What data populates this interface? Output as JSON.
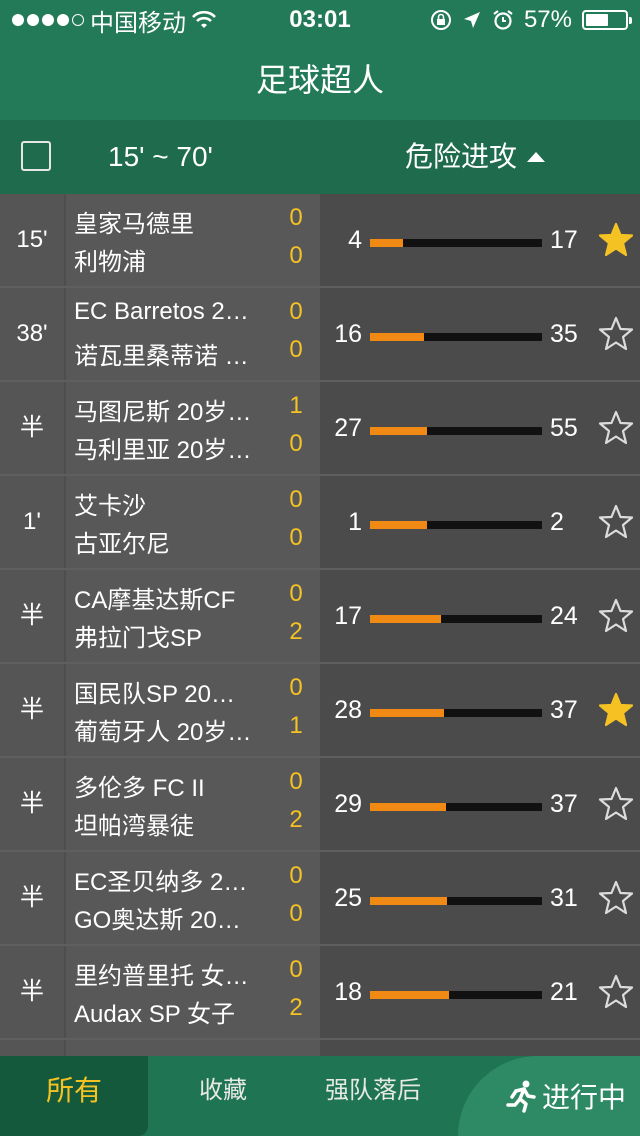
{
  "status_bar": {
    "carrier": "中国移动",
    "time": "03:01",
    "battery": "57%",
    "battery_level": 0.57
  },
  "title": "足球超人",
  "header": {
    "range": "15' ~ 70'",
    "sort_column": "危险进攻"
  },
  "colors": {
    "accent": "#237a59",
    "score": "#f5c223",
    "bar_fill": "#f08a14",
    "star": "#f5c223"
  },
  "matches": [
    {
      "minute": "15'",
      "home": "皇家马德里",
      "away": "利物浦",
      "home_score": "0",
      "away_score": "0",
      "stat_home": "4",
      "stat_away": "17",
      "starred": true
    },
    {
      "minute": "38'",
      "home": "EC Barretos 2…",
      "away": "诺瓦里桑蒂诺 …",
      "home_score": "0",
      "away_score": "0",
      "stat_home": "16",
      "stat_away": "35",
      "starred": false
    },
    {
      "minute": "半",
      "home": "马图尼斯 20岁…",
      "away": "马利里亚 20岁…",
      "home_score": "1",
      "away_score": "0",
      "stat_home": "27",
      "stat_away": "55",
      "starred": false
    },
    {
      "minute": "1'",
      "home": "艾卡沙",
      "away": "古亚尔尼",
      "home_score": "0",
      "away_score": "0",
      "stat_home": "1",
      "stat_away": "2",
      "starred": false
    },
    {
      "minute": "半",
      "home": "CA摩基达斯CF",
      "away": "弗拉门戈SP",
      "home_score": "0",
      "away_score": "2",
      "stat_home": "17",
      "stat_away": "24",
      "starred": false
    },
    {
      "minute": "半",
      "home": "国民队SP 20…",
      "away": "葡萄牙人 20岁…",
      "home_score": "0",
      "away_score": "1",
      "stat_home": "28",
      "stat_away": "37",
      "starred": true
    },
    {
      "minute": "半",
      "home": "多伦多 FC II",
      "away": "坦帕湾暴徒",
      "home_score": "0",
      "away_score": "2",
      "stat_home": "29",
      "stat_away": "37",
      "starred": false
    },
    {
      "minute": "半",
      "home": "EC圣贝纳多 2…",
      "away": "GO奥达斯 20…",
      "home_score": "0",
      "away_score": "0",
      "stat_home": "25",
      "stat_away": "31",
      "starred": false
    },
    {
      "minute": "半",
      "home": "里约普里托 女…",
      "away": "Audax SP 女子",
      "home_score": "0",
      "away_score": "2",
      "stat_home": "18",
      "stat_away": "21",
      "starred": false
    }
  ],
  "tabs": {
    "all": "所有",
    "favorites": "收藏",
    "strong_behind": "强队落后",
    "live": "进行中"
  }
}
